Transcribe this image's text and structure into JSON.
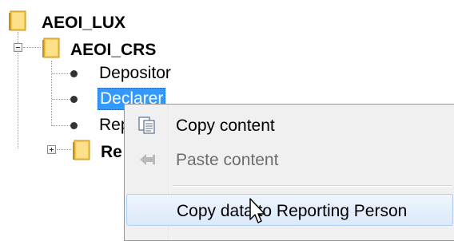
{
  "tree": {
    "root": {
      "label": "AEOI_LUX",
      "icon": "folder-icon"
    },
    "child": {
      "label": "AEOI_CRS",
      "icon": "folder-icon"
    },
    "leaves": [
      {
        "label": "Depositor"
      },
      {
        "label": "Declarer"
      },
      {
        "label": "Rep"
      }
    ],
    "collapsed_folder": {
      "label": "Re",
      "icon": "folder-icon"
    }
  },
  "context_menu": {
    "items": [
      {
        "label": "Copy content",
        "icon": "copy-icon",
        "enabled": true
      },
      {
        "label": "Paste content",
        "icon": "paste-icon",
        "enabled": false
      },
      {
        "label": "Copy data to Reporting Person",
        "enabled": true,
        "hovered": true
      }
    ]
  },
  "colors": {
    "selection": "#3399ff",
    "folder": "#e8b640",
    "menu_background": "#f0f0f0"
  }
}
